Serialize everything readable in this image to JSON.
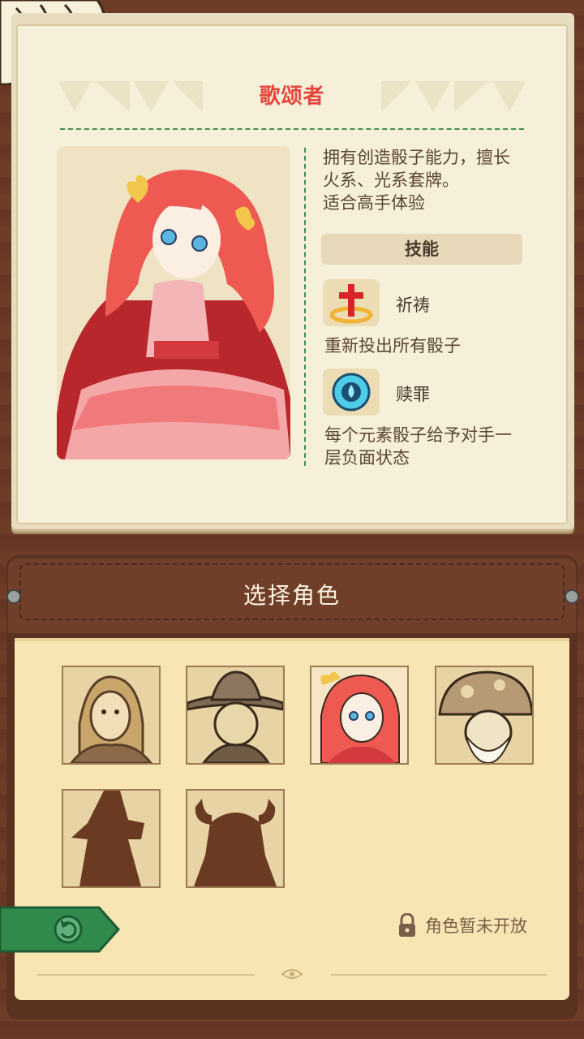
{
  "character": {
    "name": "歌颂者",
    "description_lines": [
      "拥有创造骰子能力，擅长",
      "火系、光系套牌。",
      "适合高手体验"
    ]
  },
  "skills": {
    "header": "技能",
    "items": [
      {
        "name": "祈祷",
        "icon": "prayer-cross-icon",
        "description_lines": [
          "重新投出所有骰子"
        ]
      },
      {
        "name": "赎罪",
        "icon": "blue-skull-icon",
        "description_lines": [
          "每个元素骰子给予对手一",
          "层负面状态"
        ]
      }
    ]
  },
  "selection": {
    "title": "选择角色",
    "slots": [
      {
        "id": "scholar",
        "state": "available"
      },
      {
        "id": "cowboy",
        "state": "available"
      },
      {
        "id": "praiser",
        "state": "selected"
      },
      {
        "id": "mushroom-elder",
        "state": "available"
      },
      {
        "id": "witch-silhouette",
        "state": "locked"
      },
      {
        "id": "viking-silhouette",
        "state": "locked"
      }
    ],
    "locked_note": "角色暂未开放"
  },
  "colors": {
    "accent_red": "#e4463d",
    "dashed_green": "#3f8f52",
    "back_green": "#2f8a4c"
  }
}
